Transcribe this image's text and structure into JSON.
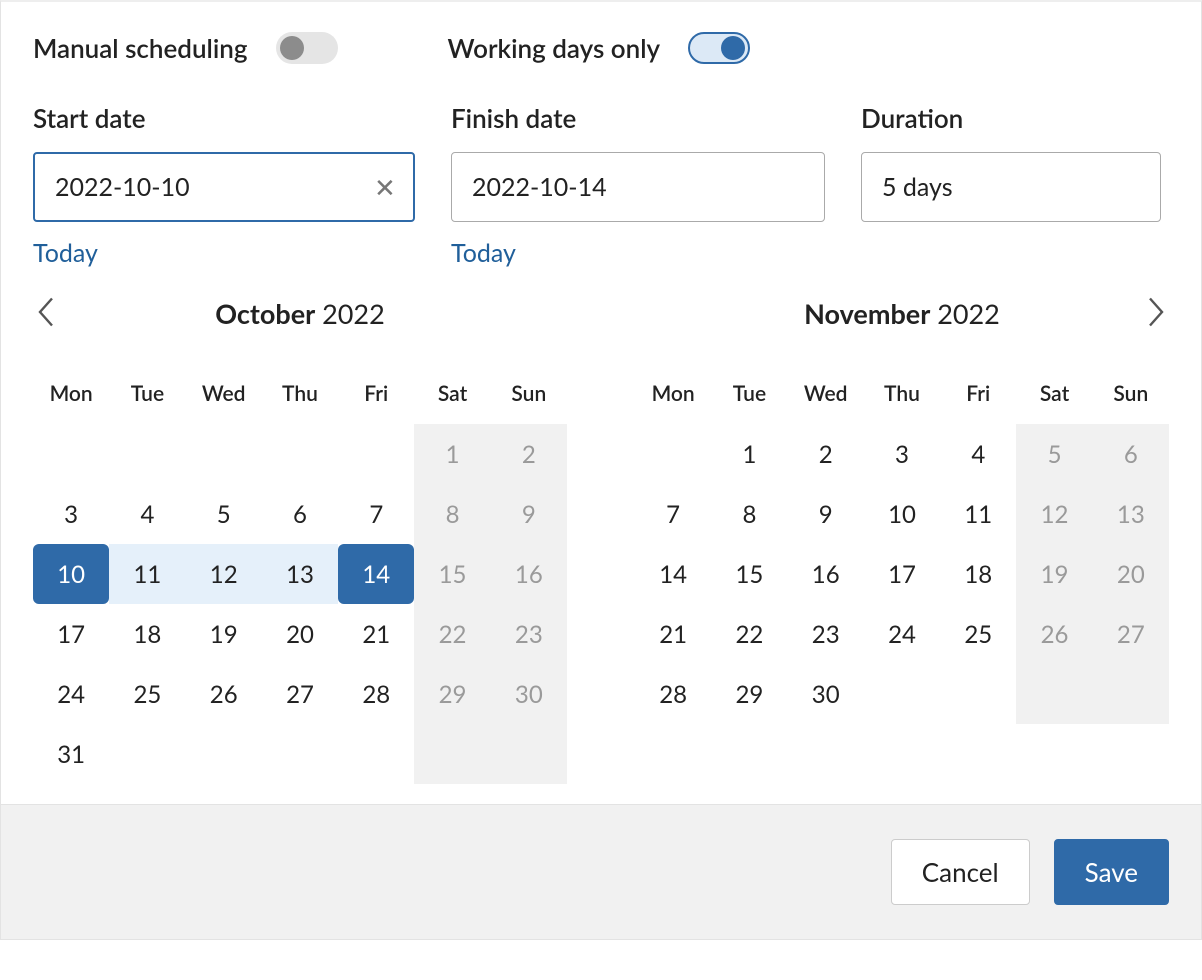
{
  "toggles": {
    "manual_label": "Manual scheduling",
    "manual_on": false,
    "working_label": "Working days only",
    "working_on": true
  },
  "fields": {
    "start_label": "Start date",
    "start_value": "2022-10-10",
    "start_today": "Today",
    "finish_label": "Finish date",
    "finish_value": "2022-10-14",
    "finish_today": "Today",
    "duration_label": "Duration",
    "duration_value": "5 days"
  },
  "calendars": {
    "dow": [
      "Mon",
      "Tue",
      "Wed",
      "Thu",
      "Fri",
      "Sat",
      "Sun"
    ],
    "left": {
      "month": "October",
      "year": "2022",
      "lead_blanks": 5,
      "days": 31,
      "range_start": 10,
      "range_end": 14
    },
    "right": {
      "month": "November",
      "year": "2022",
      "lead_blanks": 1,
      "days": 30,
      "range_start": null,
      "range_end": null
    }
  },
  "footer": {
    "cancel": "Cancel",
    "save": "Save"
  }
}
